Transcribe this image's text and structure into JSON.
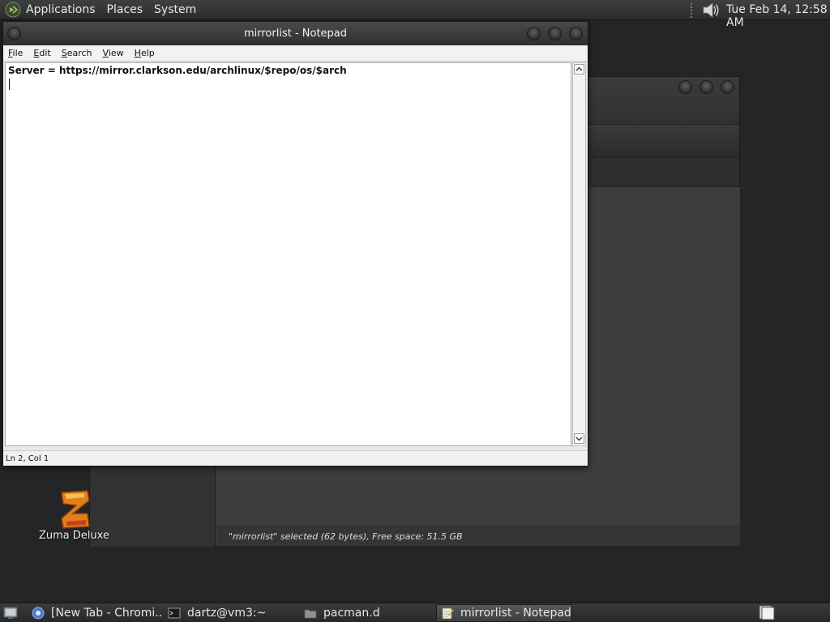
{
  "top_panel": {
    "menus": [
      "Applications",
      "Places",
      "System"
    ],
    "clock": "Tue Feb 14, 12:58 AM",
    "icons": {
      "logo": "gnome-foot-logo-icon",
      "volume": "volume-icon"
    }
  },
  "file_manager": {
    "status_text": "\"mirrorlist\" selected (62 bytes), Free space: 51.5 GB",
    "icons": {
      "dropdown": "chevron-down-icon",
      "search": "search-icon"
    }
  },
  "desktop": {
    "icons": [
      {
        "label": "Zuma Deluxe",
        "icon": "zuma-game-icon"
      }
    ]
  },
  "notepad": {
    "title": "mirrorlist - Notepad",
    "menus": [
      {
        "accel": "F",
        "rest": "ile"
      },
      {
        "accel": "E",
        "rest": "dit"
      },
      {
        "accel": "S",
        "rest": "earch"
      },
      {
        "accel": "V",
        "rest": "iew"
      },
      {
        "accel": "H",
        "rest": "elp"
      }
    ],
    "content_lines": [
      "Server = https://mirror.clarkson.edu/archlinux/$repo/os/$arch",
      ""
    ],
    "status": "Ln 2, Col 1"
  },
  "taskbar": {
    "tasks": [
      {
        "label": "[New Tab - Chromi...",
        "icon": "chromium-icon"
      },
      {
        "label": "dartz@vm3:~",
        "icon": "terminal-icon"
      },
      {
        "label": "pacman.d",
        "icon": "folder-icon"
      },
      {
        "label": "mirrorlist - Notepad",
        "icon": "notepad-icon",
        "active": true
      }
    ]
  },
  "colors": {
    "desktop_bg": "#242526",
    "panel_bg": "#333436",
    "notepad_editor_bg": "#ffffff",
    "search_icon_blue": "#2e5fd8"
  }
}
